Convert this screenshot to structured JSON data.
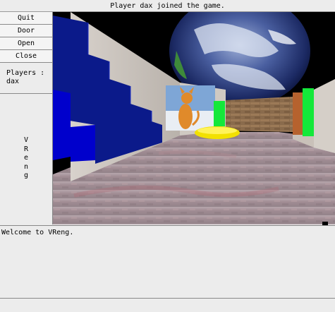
{
  "status_message": "Player dax joined the game.",
  "sidebar": {
    "buttons": [
      {
        "label": "Quit"
      },
      {
        "label": "Door"
      },
      {
        "label": "Open"
      },
      {
        "label": "Close"
      }
    ],
    "players_label": "Players :",
    "players": [
      "dax"
    ],
    "vertical_title": [
      "V",
      "R",
      "e",
      "n",
      "g"
    ]
  },
  "console": {
    "messages": [
      "Welcome to VReng."
    ]
  },
  "input": {
    "value": ""
  },
  "colors": {
    "sky": "#000000",
    "stairs": "#0b1a8a",
    "stairs_front": "#0000cc",
    "green_panel": "#14e83a",
    "yellow_object": "#f2e100",
    "brick_wall": "#8b6a4a",
    "floor": "#a58d95"
  },
  "icons": {
    "text_cursor": "text-cursor-icon"
  }
}
